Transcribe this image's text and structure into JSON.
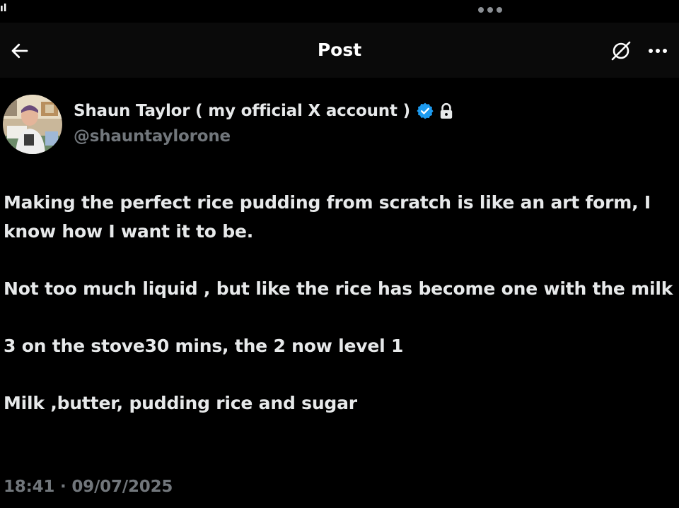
{
  "status_bar": {
    "signal": "ıl"
  },
  "nav": {
    "title": "Post",
    "back_icon": "arrow-left-icon",
    "grok_icon": "grok-icon",
    "more_icon": "more-horizontal-icon"
  },
  "author": {
    "display_name": "Shaun Taylor ( my official X account )",
    "handle": "@shauntaylorone",
    "verified_badge": "verified-badge-icon",
    "protected_icon": "lock-icon"
  },
  "post": {
    "paragraphs": [
      "Making the perfect rice pudding from scratch is like an art form, I know how I want it to be.",
      "Not too much liquid , but like the rice has become one with the milk",
      "3 on the stove30 mins, the 2 now level 1",
      "Milk ,butter, pudding rice and sugar"
    ],
    "timestamp": "18:41 · 09/07/2025"
  },
  "colors": {
    "background": "#000000",
    "text": "#e7e9ea",
    "secondary_text": "#71767b",
    "verified_blue": "#1d9bf0"
  }
}
